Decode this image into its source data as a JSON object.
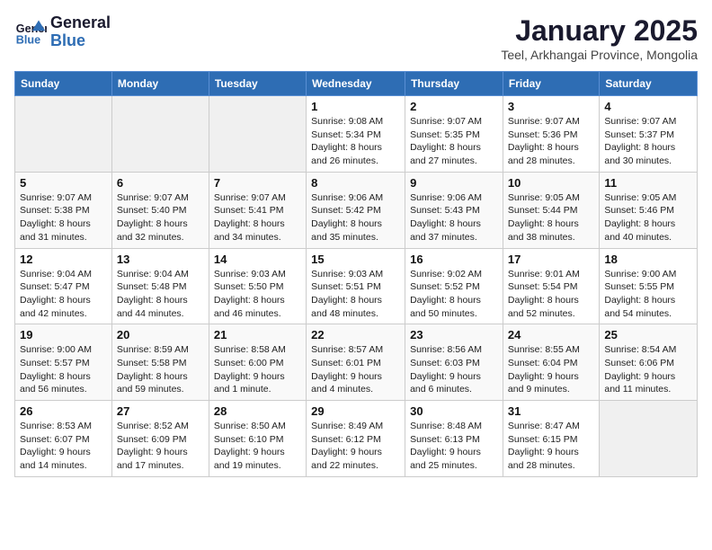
{
  "header": {
    "logo_line1": "General",
    "logo_line2": "Blue",
    "month": "January 2025",
    "location": "Teel, Arkhangai Province, Mongolia"
  },
  "days_of_week": [
    "Sunday",
    "Monday",
    "Tuesday",
    "Wednesday",
    "Thursday",
    "Friday",
    "Saturday"
  ],
  "weeks": [
    [
      {
        "day": "",
        "info": ""
      },
      {
        "day": "",
        "info": ""
      },
      {
        "day": "",
        "info": ""
      },
      {
        "day": "1",
        "info": "Sunrise: 9:08 AM\nSunset: 5:34 PM\nDaylight: 8 hours and 26 minutes."
      },
      {
        "day": "2",
        "info": "Sunrise: 9:07 AM\nSunset: 5:35 PM\nDaylight: 8 hours and 27 minutes."
      },
      {
        "day": "3",
        "info": "Sunrise: 9:07 AM\nSunset: 5:36 PM\nDaylight: 8 hours and 28 minutes."
      },
      {
        "day": "4",
        "info": "Sunrise: 9:07 AM\nSunset: 5:37 PM\nDaylight: 8 hours and 30 minutes."
      }
    ],
    [
      {
        "day": "5",
        "info": "Sunrise: 9:07 AM\nSunset: 5:38 PM\nDaylight: 8 hours and 31 minutes."
      },
      {
        "day": "6",
        "info": "Sunrise: 9:07 AM\nSunset: 5:40 PM\nDaylight: 8 hours and 32 minutes."
      },
      {
        "day": "7",
        "info": "Sunrise: 9:07 AM\nSunset: 5:41 PM\nDaylight: 8 hours and 34 minutes."
      },
      {
        "day": "8",
        "info": "Sunrise: 9:06 AM\nSunset: 5:42 PM\nDaylight: 8 hours and 35 minutes."
      },
      {
        "day": "9",
        "info": "Sunrise: 9:06 AM\nSunset: 5:43 PM\nDaylight: 8 hours and 37 minutes."
      },
      {
        "day": "10",
        "info": "Sunrise: 9:05 AM\nSunset: 5:44 PM\nDaylight: 8 hours and 38 minutes."
      },
      {
        "day": "11",
        "info": "Sunrise: 9:05 AM\nSunset: 5:46 PM\nDaylight: 8 hours and 40 minutes."
      }
    ],
    [
      {
        "day": "12",
        "info": "Sunrise: 9:04 AM\nSunset: 5:47 PM\nDaylight: 8 hours and 42 minutes."
      },
      {
        "day": "13",
        "info": "Sunrise: 9:04 AM\nSunset: 5:48 PM\nDaylight: 8 hours and 44 minutes."
      },
      {
        "day": "14",
        "info": "Sunrise: 9:03 AM\nSunset: 5:50 PM\nDaylight: 8 hours and 46 minutes."
      },
      {
        "day": "15",
        "info": "Sunrise: 9:03 AM\nSunset: 5:51 PM\nDaylight: 8 hours and 48 minutes."
      },
      {
        "day": "16",
        "info": "Sunrise: 9:02 AM\nSunset: 5:52 PM\nDaylight: 8 hours and 50 minutes."
      },
      {
        "day": "17",
        "info": "Sunrise: 9:01 AM\nSunset: 5:54 PM\nDaylight: 8 hours and 52 minutes."
      },
      {
        "day": "18",
        "info": "Sunrise: 9:00 AM\nSunset: 5:55 PM\nDaylight: 8 hours and 54 minutes."
      }
    ],
    [
      {
        "day": "19",
        "info": "Sunrise: 9:00 AM\nSunset: 5:57 PM\nDaylight: 8 hours and 56 minutes."
      },
      {
        "day": "20",
        "info": "Sunrise: 8:59 AM\nSunset: 5:58 PM\nDaylight: 8 hours and 59 minutes."
      },
      {
        "day": "21",
        "info": "Sunrise: 8:58 AM\nSunset: 6:00 PM\nDaylight: 9 hours and 1 minute."
      },
      {
        "day": "22",
        "info": "Sunrise: 8:57 AM\nSunset: 6:01 PM\nDaylight: 9 hours and 4 minutes."
      },
      {
        "day": "23",
        "info": "Sunrise: 8:56 AM\nSunset: 6:03 PM\nDaylight: 9 hours and 6 minutes."
      },
      {
        "day": "24",
        "info": "Sunrise: 8:55 AM\nSunset: 6:04 PM\nDaylight: 9 hours and 9 minutes."
      },
      {
        "day": "25",
        "info": "Sunrise: 8:54 AM\nSunset: 6:06 PM\nDaylight: 9 hours and 11 minutes."
      }
    ],
    [
      {
        "day": "26",
        "info": "Sunrise: 8:53 AM\nSunset: 6:07 PM\nDaylight: 9 hours and 14 minutes."
      },
      {
        "day": "27",
        "info": "Sunrise: 8:52 AM\nSunset: 6:09 PM\nDaylight: 9 hours and 17 minutes."
      },
      {
        "day": "28",
        "info": "Sunrise: 8:50 AM\nSunset: 6:10 PM\nDaylight: 9 hours and 19 minutes."
      },
      {
        "day": "29",
        "info": "Sunrise: 8:49 AM\nSunset: 6:12 PM\nDaylight: 9 hours and 22 minutes."
      },
      {
        "day": "30",
        "info": "Sunrise: 8:48 AM\nSunset: 6:13 PM\nDaylight: 9 hours and 25 minutes."
      },
      {
        "day": "31",
        "info": "Sunrise: 8:47 AM\nSunset: 6:15 PM\nDaylight: 9 hours and 28 minutes."
      },
      {
        "day": "",
        "info": ""
      }
    ]
  ]
}
